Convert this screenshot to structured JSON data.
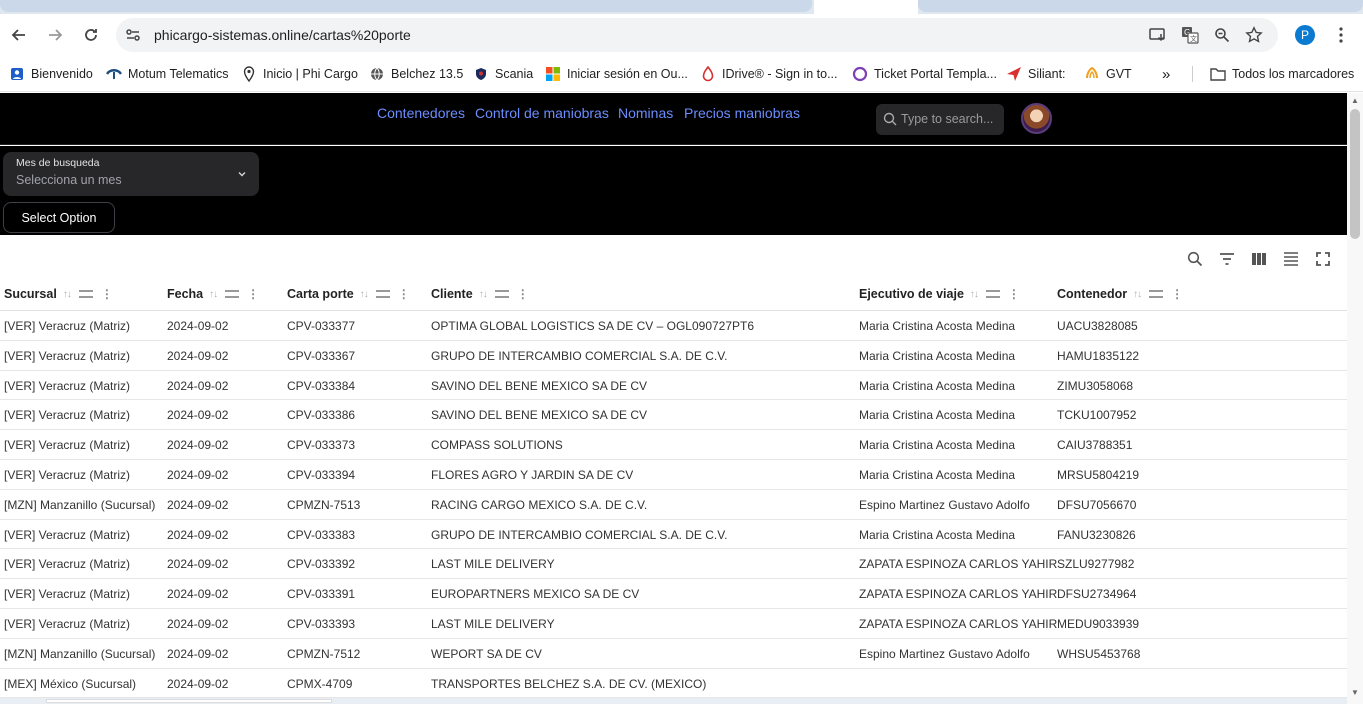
{
  "browser": {
    "url": "phicargo-sistemas.online/cartas%20porte",
    "profile_initial": "P"
  },
  "bookmarks": [
    {
      "label": "Bienvenido",
      "icon": "person-badge-icon"
    },
    {
      "label": "Motum Telematics",
      "icon": "motum-icon"
    },
    {
      "label": "Inicio | Phi Cargo",
      "icon": "location-pin-icon"
    },
    {
      "label": "Belchez 13.5",
      "icon": "globe-icon"
    },
    {
      "label": "Scania",
      "icon": "scania-shield-icon"
    },
    {
      "label": "Iniciar sesión en Ou...",
      "icon": "microsoft-icon"
    },
    {
      "label": "IDrive® - Sign in to...",
      "icon": "idrive-icon"
    },
    {
      "label": "Ticket Portal Templa...",
      "icon": "ring-icon"
    },
    {
      "label": "Siliant:",
      "icon": "arrow-send-icon"
    },
    {
      "label": "GVT",
      "icon": "gvt-icon"
    }
  ],
  "bookmarks_all_label": "Todos los marcadores",
  "app": {
    "nav": [
      "Contenedores",
      "Control de maniobras",
      "Nominas",
      "Precios maniobras"
    ],
    "search_placeholder": "Type to search...",
    "filter": {
      "label": "Mes de busqueda",
      "placeholder": "Selecciona un mes",
      "button": "Select Option"
    },
    "colors": {
      "nav_link": "#6b8dff",
      "header_bg": "#000000"
    }
  },
  "table": {
    "columns": [
      "Sucursal",
      "Fecha",
      "Carta porte",
      "Cliente",
      "Ejecutivo de viaje",
      "Contenedor"
    ],
    "rows": [
      [
        "[VER] Veracruz (Matriz)",
        "2024-09-02",
        "CPV-033377",
        "OPTIMA GLOBAL LOGISTICS SA DE CV – OGL090727PT6",
        "Maria Cristina Acosta Medina",
        "UACU3828085"
      ],
      [
        "[VER] Veracruz (Matriz)",
        "2024-09-02",
        "CPV-033367",
        "GRUPO DE INTERCAMBIO COMERCIAL S.A. DE C.V.",
        "Maria Cristina Acosta Medina",
        "HAMU1835122"
      ],
      [
        "[VER] Veracruz (Matriz)",
        "2024-09-02",
        "CPV-033384",
        "SAVINO DEL BENE MEXICO SA DE CV",
        "Maria Cristina Acosta Medina",
        "ZIMU3058068"
      ],
      [
        "[VER] Veracruz (Matriz)",
        "2024-09-02",
        "CPV-033386",
        "SAVINO DEL BENE MEXICO SA DE CV",
        "Maria Cristina Acosta Medina",
        "TCKU1007952"
      ],
      [
        "[VER] Veracruz (Matriz)",
        "2024-09-02",
        "CPV-033373",
        "COMPASS SOLUTIONS",
        "Maria Cristina Acosta Medina",
        "CAIU3788351"
      ],
      [
        "[VER] Veracruz (Matriz)",
        "2024-09-02",
        "CPV-033394",
        "FLORES AGRO Y JARDIN SA DE CV",
        "Maria Cristina Acosta Medina",
        "MRSU5804219"
      ],
      [
        "[MZN] Manzanillo (Sucursal)",
        "2024-09-02",
        "CPMZN-7513",
        "RACING CARGO MEXICO S.A. DE C.V.",
        "Espino Martinez Gustavo Adolfo",
        "DFSU7056670"
      ],
      [
        "[VER] Veracruz (Matriz)",
        "2024-09-02",
        "CPV-033383",
        "GRUPO DE INTERCAMBIO COMERCIAL S.A. DE C.V.",
        "Maria Cristina Acosta Medina",
        "FANU3230826"
      ],
      [
        "[VER] Veracruz (Matriz)",
        "2024-09-02",
        "CPV-033392",
        "LAST MILE DELIVERY",
        "ZAPATA ESPINOZA CARLOS YAHIR",
        "SZLU9277982"
      ],
      [
        "[VER] Veracruz (Matriz)",
        "2024-09-02",
        "CPV-033391",
        "EUROPARTNERS MEXICO SA DE CV",
        "ZAPATA ESPINOZA CARLOS YAHIR",
        "DFSU2734964"
      ],
      [
        "[VER] Veracruz (Matriz)",
        "2024-09-02",
        "CPV-033393",
        "LAST MILE DELIVERY",
        "ZAPATA ESPINOZA CARLOS YAHIR",
        "MEDU9033939"
      ],
      [
        "[MZN] Manzanillo (Sucursal)",
        "2024-09-02",
        "CPMZN-7512",
        "WEPORT SA DE CV",
        "Espino Martinez Gustavo Adolfo",
        "WHSU5453768"
      ],
      [
        "[MEX] México (Sucursal)",
        "2024-09-02",
        "CPMX-4709",
        "TRANSPORTES BELCHEZ S.A. DE CV. (MEXICO)",
        "",
        ""
      ]
    ]
  }
}
